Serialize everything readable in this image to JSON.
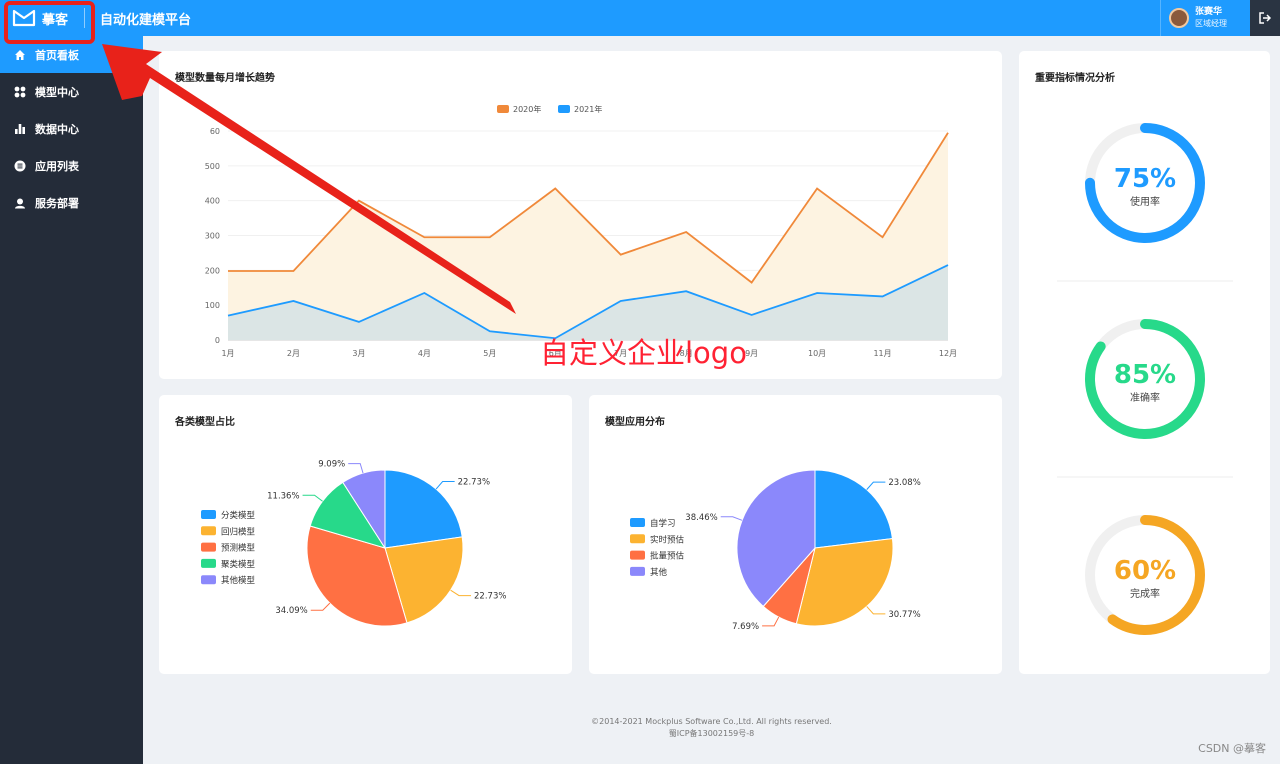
{
  "header": {
    "logo_text": "摹客",
    "app_title": "自动化建模平台",
    "user_name": "张赛华",
    "user_role": "区域经理"
  },
  "sidebar": {
    "items": [
      {
        "label": "首页看板",
        "icon": "home-icon",
        "active": true
      },
      {
        "label": "模型中心",
        "icon": "grid-icon",
        "active": false
      },
      {
        "label": "数据中心",
        "icon": "bar-chart-icon",
        "active": false
      },
      {
        "label": "应用列表",
        "icon": "list-circle-icon",
        "active": false
      },
      {
        "label": "服务部署",
        "icon": "user-service-icon",
        "active": false
      }
    ]
  },
  "cards": {
    "line_title": "模型数量每月增长趋势",
    "kpi_title": "重要指标情况分析",
    "pie1_title": "各类模型占比",
    "pie2_title": "模型应用分布"
  },
  "colors": {
    "primary": "#1e9bff",
    "orange": "#f0893a",
    "green": "#27d98a",
    "amber": "#f5a623",
    "annotation": "#e8221a"
  },
  "chart_data": [
    {
      "type": "area",
      "title": "模型数量每月增长趋势",
      "categories": [
        "1月",
        "2月",
        "3月",
        "4月",
        "5月",
        "6月",
        "7月",
        "8月",
        "9月",
        "10月",
        "11月",
        "12月"
      ],
      "yticks": [
        "0",
        "100",
        "200",
        "300",
        "400",
        "500",
        "60"
      ],
      "ylim": [
        0,
        600
      ],
      "legend_position": "top-center",
      "series": [
        {
          "name": "2020年",
          "color": "#f0893a",
          "values": [
            198,
            198,
            400,
            295,
            295,
            435,
            245,
            310,
            165,
            435,
            295,
            595
          ]
        },
        {
          "name": "2021年",
          "color": "#1e9bff",
          "values": [
            70,
            112,
            52,
            135,
            25,
            5,
            112,
            140,
            72,
            135,
            125,
            215
          ]
        }
      ]
    },
    {
      "type": "pie",
      "title": "各类模型占比",
      "legend_position": "left",
      "slices": [
        {
          "name": "分类模型",
          "value": 22.73,
          "label": "22.73%",
          "color": "#1e9bff"
        },
        {
          "name": "回归模型",
          "value": 22.73,
          "label": "22.73%",
          "color": "#fcb331"
        },
        {
          "name": "预测模型",
          "value": 34.09,
          "label": "34.09%",
          "color": "#ff7043"
        },
        {
          "name": "聚类模型",
          "value": 11.36,
          "label": "11.36%",
          "color": "#27d98a"
        },
        {
          "name": "其他模型",
          "value": 9.09,
          "label": "9.09%",
          "color": "#8b88fb"
        }
      ]
    },
    {
      "type": "pie",
      "title": "模型应用分布",
      "legend_position": "left",
      "slices": [
        {
          "name": "自学习",
          "value": 23.08,
          "label": "23.08%",
          "color": "#1e9bff"
        },
        {
          "name": "实时预估",
          "value": 30.77,
          "label": "30.77%",
          "color": "#fcb331"
        },
        {
          "name": "批量预估",
          "value": 7.69,
          "label": "7.69%",
          "color": "#ff7043"
        },
        {
          "name": "其他",
          "value": 38.46,
          "label": "38.46%",
          "color": "#8b88fb"
        }
      ]
    }
  ],
  "kpis": [
    {
      "value": "75%",
      "label": "使用率",
      "fraction": 0.75,
      "color": "#1e9bff"
    },
    {
      "value": "85%",
      "label": "准确率",
      "fraction": 0.85,
      "color": "#27d98a"
    },
    {
      "value": "60%",
      "label": "完成率",
      "fraction": 0.6,
      "color": "#f5a623"
    }
  ],
  "footer": {
    "line1": "©2014-2021 Mockplus Software Co.,Ltd. All rights reserved.",
    "line2": "蜀ICP备13002159号-8"
  },
  "watermark": "CSDN @摹客",
  "annotation": {
    "text": "自定义企业logo"
  }
}
